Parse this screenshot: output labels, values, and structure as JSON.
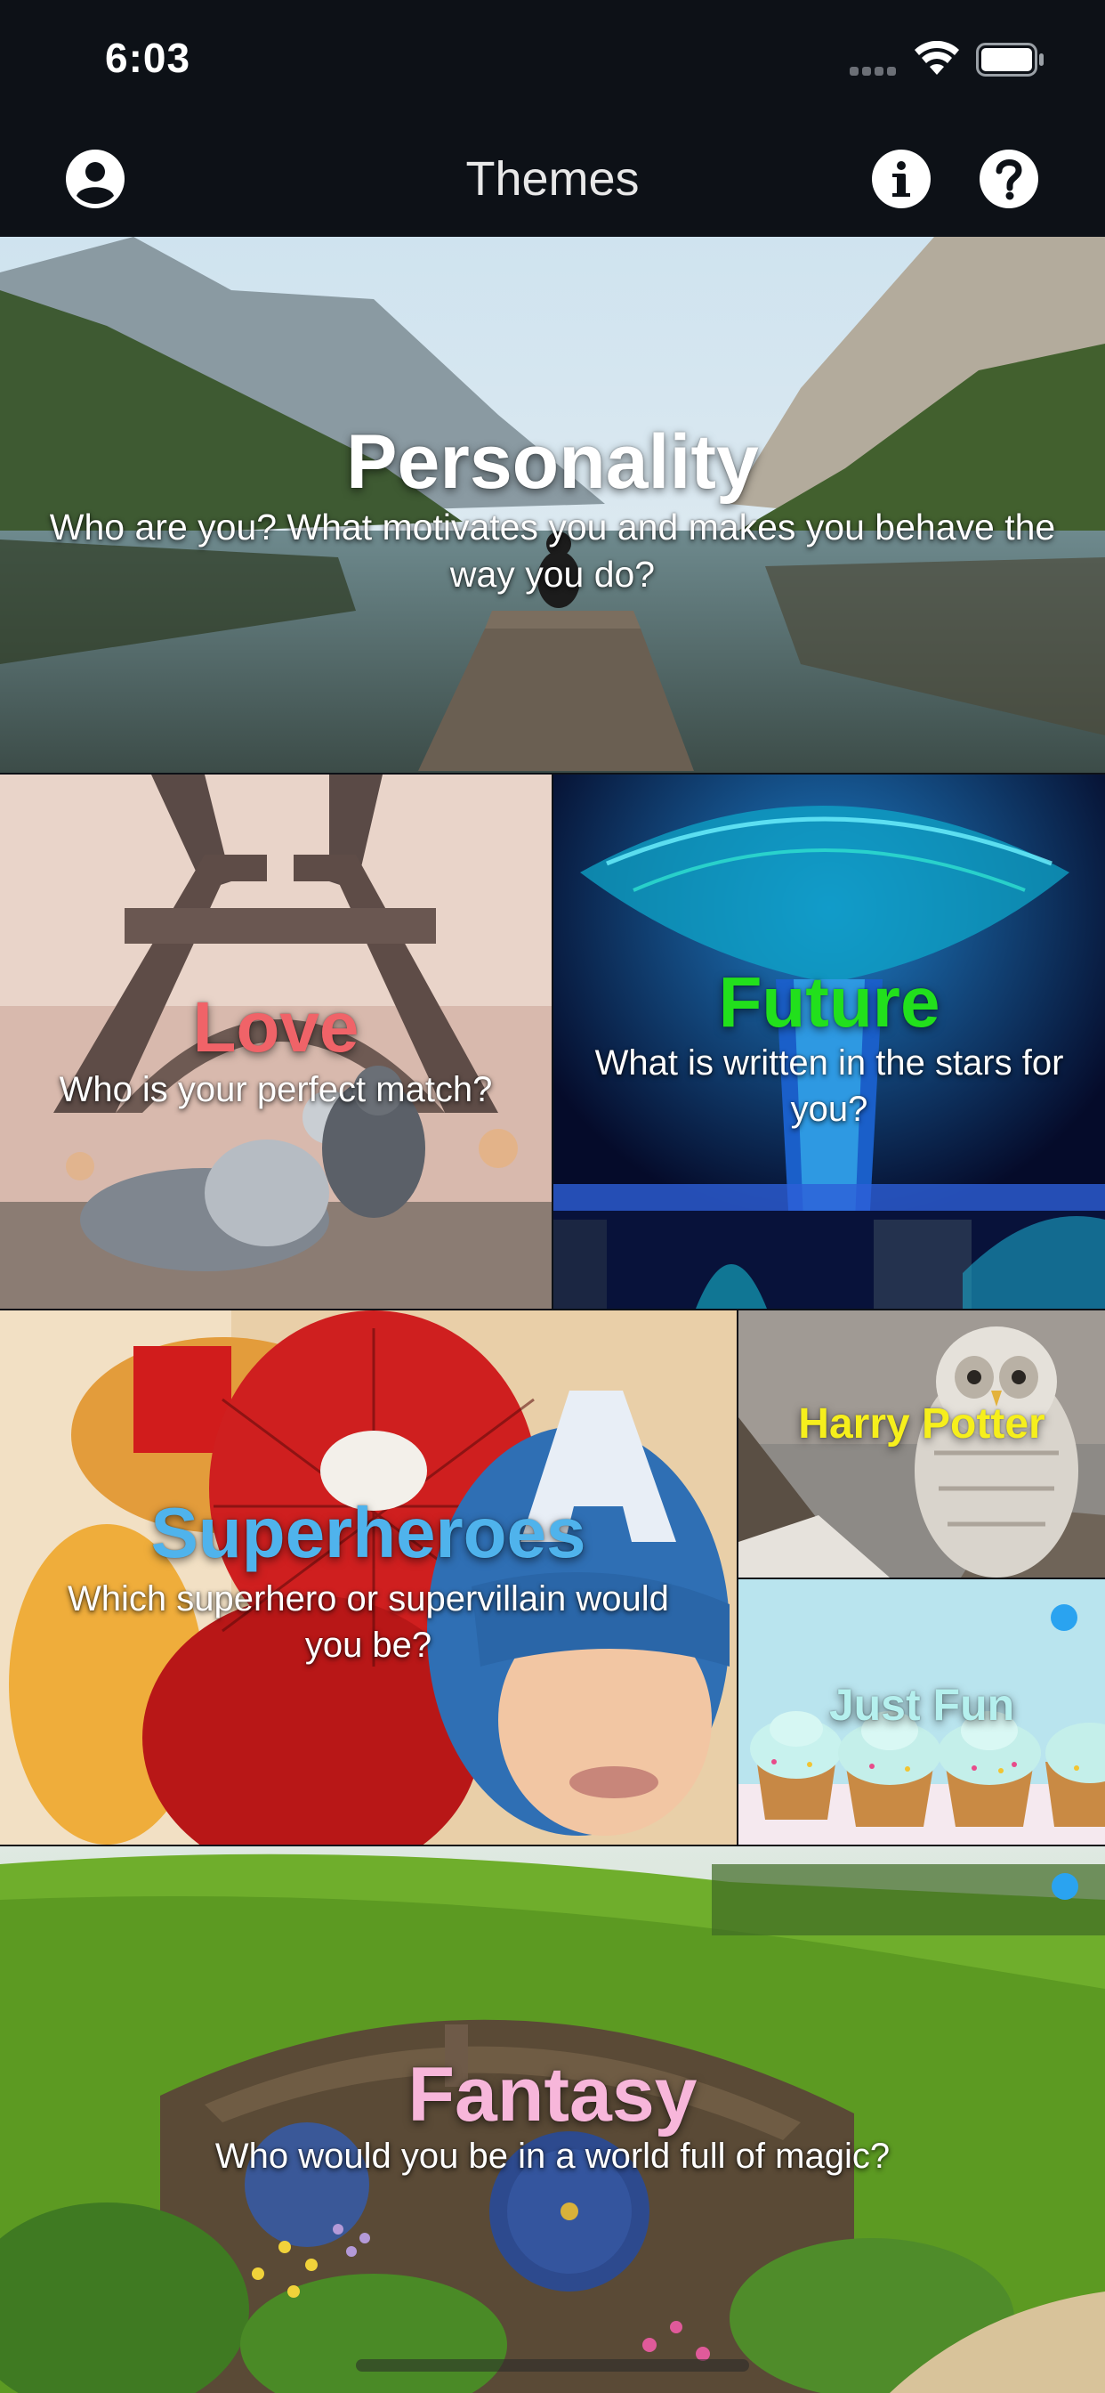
{
  "status_bar": {
    "time": "6:03",
    "icons": [
      "signal-icon",
      "wifi-icon",
      "battery-icon"
    ]
  },
  "nav": {
    "title": "Themes",
    "left_icon": "profile-icon",
    "right_icons": [
      "info-icon",
      "help-icon"
    ]
  },
  "themes": [
    {
      "title": "Personality",
      "subtitle": "Who are you? What motivates you and makes you behave the way you do?",
      "title_color": "#ffffff",
      "image": "mountain lake with person on pier"
    },
    {
      "title": "Love",
      "subtitle": "Who is your perfect match?",
      "title_color": "#f06368",
      "image": "two pigeons kissing before the Eiffel Tower"
    },
    {
      "title": "Future",
      "subtitle": "What is written in the stars for you?",
      "title_color": "#22e01c",
      "image": "illuminated futuristic supertree at night"
    },
    {
      "title": "Superheroes",
      "subtitle": "Which superhero or supervillain would you be?",
      "title_color": "#4fb3ec",
      "image": "children in superhero masks"
    },
    {
      "title": "Harry Potter",
      "subtitle": "",
      "title_color": "#f6ef1c",
      "image": "snowy owl"
    },
    {
      "title": "Just Fun",
      "subtitle": "",
      "title_color": "#b5f0ee",
      "image": "cupcakes with mint frosting",
      "badge": true
    },
    {
      "title": "Fantasy",
      "subtitle": "Who would you be in a world full of magic?",
      "title_color": "#f7b6da",
      "image": "hobbit hole in green hillside",
      "badge": true
    }
  ],
  "colors": {
    "nav_background": "#0d1117",
    "badge": "#2aa3f0"
  }
}
